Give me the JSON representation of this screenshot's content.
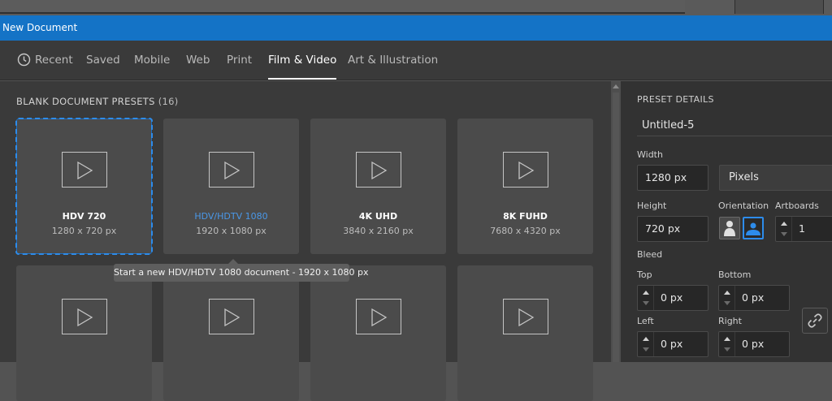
{
  "window": {
    "title": "New Document"
  },
  "tabs": [
    {
      "label": "Recent",
      "active": false
    },
    {
      "label": "Saved",
      "active": false
    },
    {
      "label": "Mobile",
      "active": false
    },
    {
      "label": "Web",
      "active": false
    },
    {
      "label": "Print",
      "active": false
    },
    {
      "label": "Film & Video",
      "active": true
    },
    {
      "label": "Art & Illustration",
      "active": false
    }
  ],
  "presets": {
    "title": "BLANK DOCUMENT PRESETS",
    "count": "(16)",
    "items": [
      {
        "name": "HDV 720",
        "dims": "1280 x 720 px",
        "selected": true
      },
      {
        "name": "HDV/HDTV 1080",
        "dims": "1920 x 1080 px",
        "hovered": true
      },
      {
        "name": "4K UHD",
        "dims": "3840 x 2160 px"
      },
      {
        "name": "8K FUHD",
        "dims": "7680 x 4320 px"
      },
      {
        "name": "",
        "dims": ""
      },
      {
        "name": "",
        "dims": ""
      },
      {
        "name": "",
        "dims": ""
      },
      {
        "name": "",
        "dims": ""
      }
    ],
    "tooltip": "Start a new HDV/HDTV 1080 document - 1920 x 1080 px"
  },
  "details": {
    "heading": "PRESET DETAILS",
    "doc_name": "Untitled-5",
    "width_label": "Width",
    "width_value": "1280 px",
    "units_value": "Pixels",
    "height_label": "Height",
    "height_value": "720 px",
    "orientation_label": "Orientation",
    "artboards_label": "Artboards",
    "artboards_value": "1",
    "bleed_label": "Bleed",
    "top_label": "Top",
    "top_value": "0 px",
    "bottom_label": "Bottom",
    "bottom_value": "0 px",
    "left_label": "Left",
    "left_value": "0 px",
    "right_label": "Right",
    "right_value": "0 px"
  },
  "colors": {
    "accent": "#1473c6",
    "selection": "#2d8ceb",
    "hover_text": "#4a98e8"
  }
}
